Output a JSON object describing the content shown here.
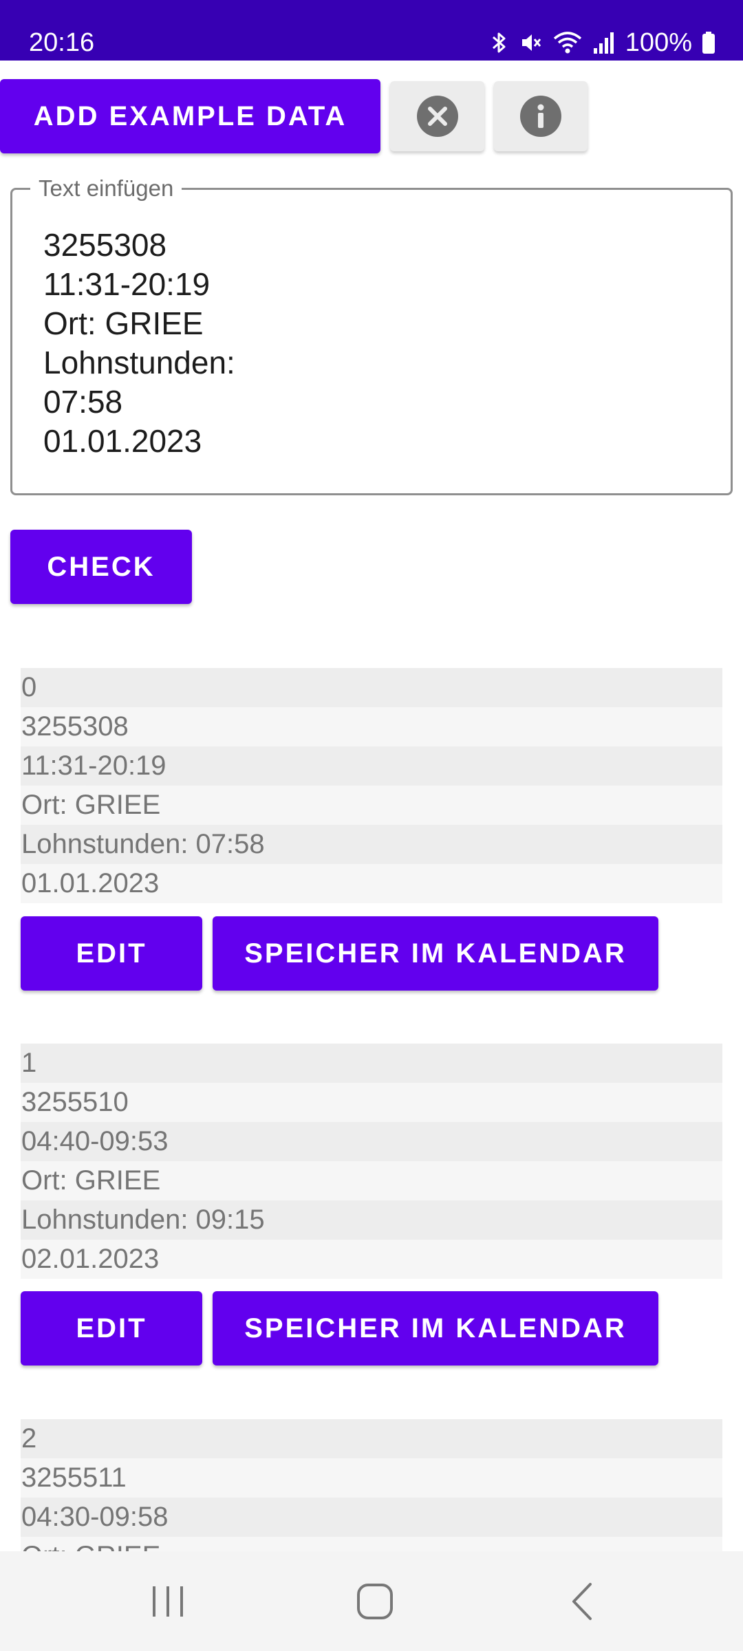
{
  "status_bar": {
    "time": "20:16",
    "battery": "100%",
    "icons": [
      "bluetooth-icon",
      "mute-icon",
      "wifi-icon",
      "signal-icon",
      "battery-icon"
    ]
  },
  "toolbar": {
    "add_example_label": "ADD EXAMPLE DATA",
    "clear_icon": "close-circle-icon",
    "info_icon": "info-icon"
  },
  "text_input": {
    "label": "Text einfügen",
    "value": "3255308\n11:31-20:19\nOrt: GRIEE\nLohnstunden:\n07:58\n01.01.2023"
  },
  "check_button": {
    "label": "CHECK"
  },
  "entries": [
    {
      "lines": [
        "0",
        "3255308",
        "11:31-20:19",
        "Ort: GRIEE",
        "Lohnstunden: 07:58",
        "01.01.2023"
      ],
      "edit_label": "EDIT",
      "save_label": "SPEICHER IM KALENDAR"
    },
    {
      "lines": [
        "1",
        "3255510",
        "04:40-09:53",
        "Ort: GRIEE",
        "Lohnstunden: 09:15",
        "02.01.2023"
      ],
      "edit_label": "EDIT",
      "save_label": "SPEICHER IM KALENDAR"
    },
    {
      "lines": [
        "2",
        "3255511",
        "04:30-09:58",
        "Ort: GRIEE"
      ]
    }
  ],
  "colors": {
    "status_bar": "#3700b3",
    "primary": "#6200ee",
    "secondary_button": "#ececec",
    "row_odd": "#ededed",
    "row_even": "#f6f6f6"
  }
}
